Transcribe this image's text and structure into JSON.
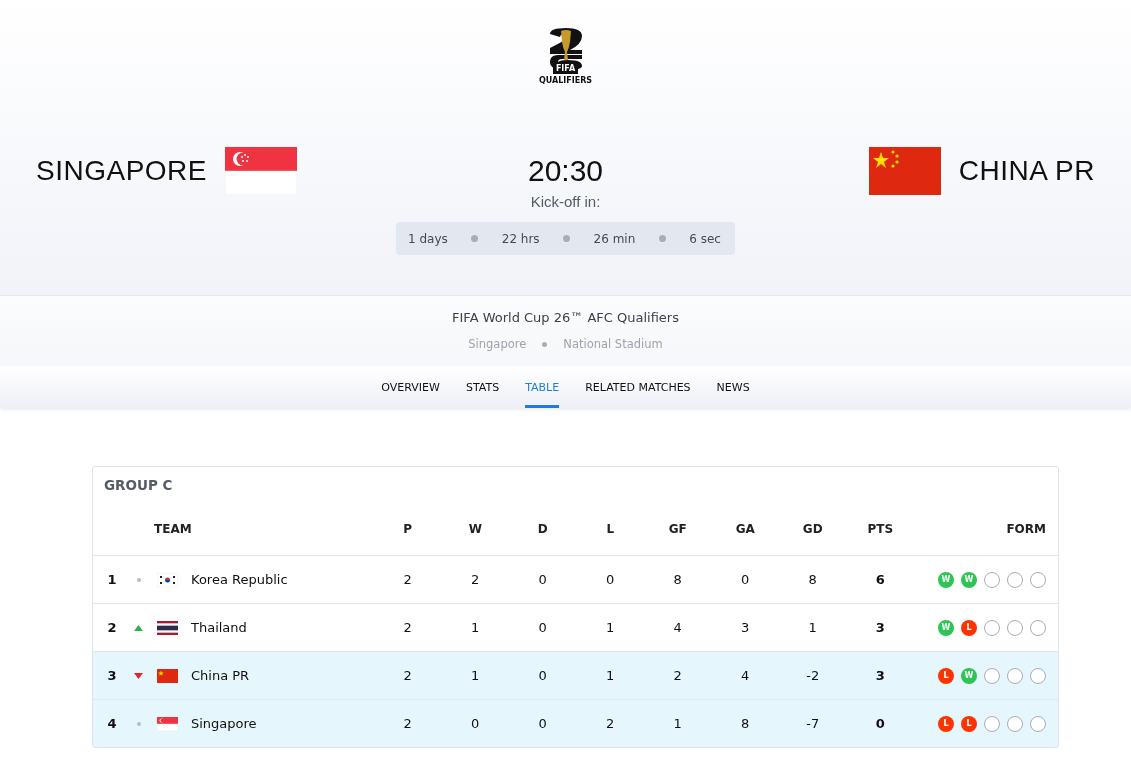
{
  "logo": {
    "brand": "FIFA",
    "caption": "QUALIFIERS"
  },
  "match": {
    "home": {
      "name": "SINGAPORE",
      "flag": {
        "kind": "singapore"
      }
    },
    "away": {
      "name": "CHINA PR",
      "flag": {
        "kind": "china"
      }
    },
    "time": "20:30",
    "kickoff_label": "Kick-off in:",
    "countdown": [
      "1 days",
      "22 hrs",
      "26 min",
      "6 sec"
    ]
  },
  "competition": "FIFA World Cup 26™ AFC Qualifiers",
  "venue": [
    "Singapore",
    "National Stadium"
  ],
  "tabs": [
    {
      "label": "OVERVIEW",
      "selected": false
    },
    {
      "label": "STATS",
      "selected": false
    },
    {
      "label": "TABLE",
      "selected": true
    },
    {
      "label": "RELATED MATCHES",
      "selected": false
    },
    {
      "label": "NEWS",
      "selected": false
    }
  ],
  "table": {
    "title": "GROUP C",
    "columns": [
      "TEAM",
      "P",
      "W",
      "D",
      "L",
      "GF",
      "GA",
      "GD",
      "PTS",
      "FORM"
    ],
    "rows": [
      {
        "rank": "1",
        "movement": {
          "kind": "same"
        },
        "flag": {
          "kind": "korea"
        },
        "team": "Korea Republic",
        "stats": [
          "2",
          "2",
          "0",
          "0",
          "8",
          "0",
          "8"
        ],
        "pts": "6",
        "highlighted": false,
        "form": [
          {
            "kind": "win",
            "label": "W"
          },
          {
            "kind": "win",
            "label": "W"
          },
          {
            "kind": "empty"
          },
          {
            "kind": "empty"
          },
          {
            "kind": "empty"
          }
        ]
      },
      {
        "rank": "2",
        "movement": {
          "kind": "up"
        },
        "flag": {
          "kind": "thailand"
        },
        "team": "Thailand",
        "stats": [
          "2",
          "1",
          "0",
          "1",
          "4",
          "3",
          "1"
        ],
        "pts": "3",
        "highlighted": false,
        "form": [
          {
            "kind": "win",
            "label": "W"
          },
          {
            "kind": "loss",
            "label": "L"
          },
          {
            "kind": "empty"
          },
          {
            "kind": "empty"
          },
          {
            "kind": "empty"
          }
        ]
      },
      {
        "rank": "3",
        "movement": {
          "kind": "down"
        },
        "flag": {
          "kind": "china"
        },
        "team": "China PR",
        "stats": [
          "2",
          "1",
          "0",
          "1",
          "2",
          "4",
          "-2"
        ],
        "pts": "3",
        "highlighted": true,
        "form": [
          {
            "kind": "loss",
            "label": "L"
          },
          {
            "kind": "win",
            "label": "W"
          },
          {
            "kind": "empty"
          },
          {
            "kind": "empty"
          },
          {
            "kind": "empty"
          }
        ]
      },
      {
        "rank": "4",
        "movement": {
          "kind": "same"
        },
        "flag": {
          "kind": "singapore"
        },
        "team": "Singapore",
        "stats": [
          "2",
          "0",
          "0",
          "2",
          "1",
          "8",
          "-7"
        ],
        "pts": "0",
        "highlighted": true,
        "form": [
          {
            "kind": "loss",
            "label": "L"
          },
          {
            "kind": "loss",
            "label": "L"
          },
          {
            "kind": "empty"
          },
          {
            "kind": "empty"
          },
          {
            "kind": "empty"
          }
        ]
      }
    ]
  }
}
